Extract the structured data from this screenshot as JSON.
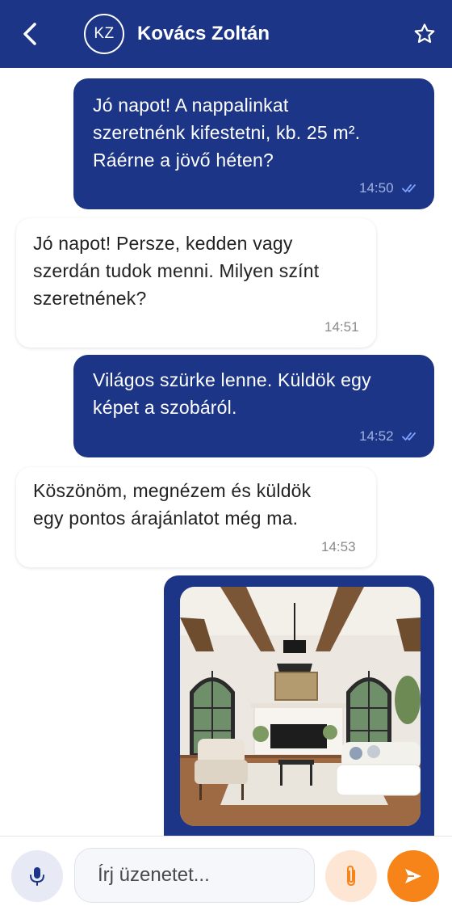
{
  "header": {
    "avatar_initials": "KZ",
    "contact_name": "Kovács Zoltán",
    "icons": {
      "back": "chevron-left-icon",
      "favorite": "star-outline-icon"
    }
  },
  "messages": [
    {
      "direction": "outgoing",
      "text": "Jó napot! A nappalinkat\nszeretnénk kifestetni, kb. 25 m².\nRáérne a jövő héten?",
      "time": "14:50",
      "status": "read"
    },
    {
      "direction": "incoming",
      "text": "Jó napot! Persze, kedden vagy\nszerdán tudok menni. Milyen színt\nszeretnének?",
      "time": "14:51"
    },
    {
      "direction": "outgoing",
      "text": "Világos szürke lenne. Küldök egy\nképet a szobáról.",
      "time": "14:52",
      "status": "read"
    },
    {
      "direction": "incoming",
      "text": "Köszönöm, megnézem és küldök\negy pontos árajánlatot még ma.",
      "time": "14:53"
    },
    {
      "direction": "outgoing",
      "type": "image",
      "image_alt": "living room photo"
    }
  ],
  "composer": {
    "placeholder": "Írj üzenetet...",
    "icons": {
      "mic": "microphone-icon",
      "attach": "paperclip-icon",
      "send": "send-icon"
    }
  },
  "colors": {
    "primary": "#1c3587",
    "accent": "#f68419",
    "read_ticks": "#7da2ff"
  }
}
